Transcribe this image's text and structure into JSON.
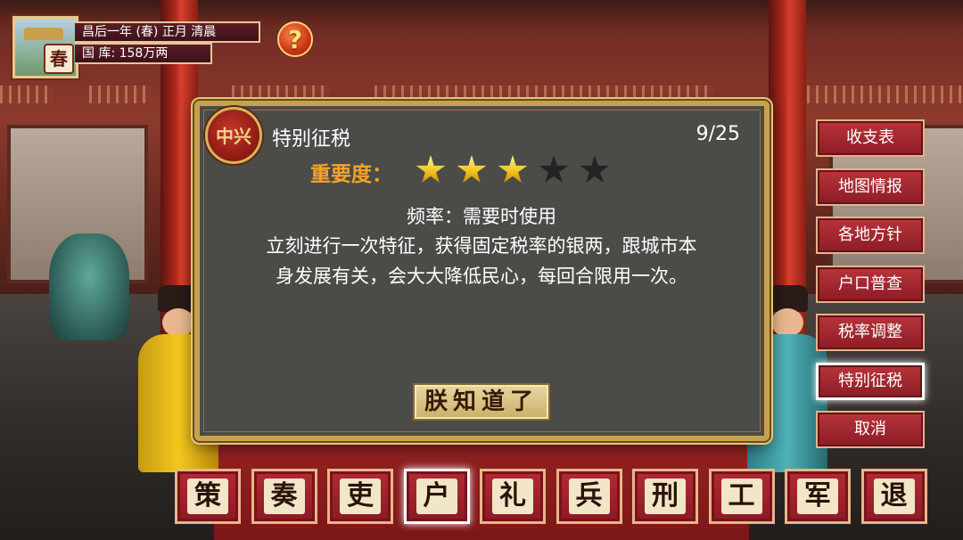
{
  "hud": {
    "season_char": "春",
    "date": "昌后一年 (春) 正月 清晨",
    "treasury": "国 库: 158万两",
    "help_label": "?"
  },
  "dialog": {
    "badge_text": "中兴",
    "title": "特别征税",
    "counter": "9/25",
    "importance_label": "重要度：",
    "importance_stars": 3,
    "importance_max": 5,
    "frequency": "频率：需要时使用",
    "description_lines": [
      "立刻进行一次特征，获得固定税率的银两，跟城市本",
      "身发展有关，会大大降低民心，每回合限用一次。"
    ],
    "confirm_label": "朕知道了"
  },
  "side_menu": [
    {
      "label": "收支表"
    },
    {
      "label": "地图情报"
    },
    {
      "label": "各地方针"
    },
    {
      "label": "户口普查"
    },
    {
      "label": "税率调整"
    },
    {
      "label": "特别征税",
      "selected": true
    },
    {
      "label": "取消"
    }
  ],
  "bottom_bar": [
    {
      "label": "策"
    },
    {
      "label": "奏"
    },
    {
      "label": "吏"
    },
    {
      "label": "户",
      "selected": true
    },
    {
      "label": "礼"
    },
    {
      "label": "兵"
    },
    {
      "label": "刑"
    },
    {
      "label": "工"
    },
    {
      "label": "军"
    },
    {
      "label": "退"
    }
  ],
  "colors": {
    "importance_label": "#f2a428",
    "star_on": "#f0c21a",
    "star_off": "#232323",
    "button_red": "#b8343a",
    "gold_border": "#c7a24e"
  }
}
